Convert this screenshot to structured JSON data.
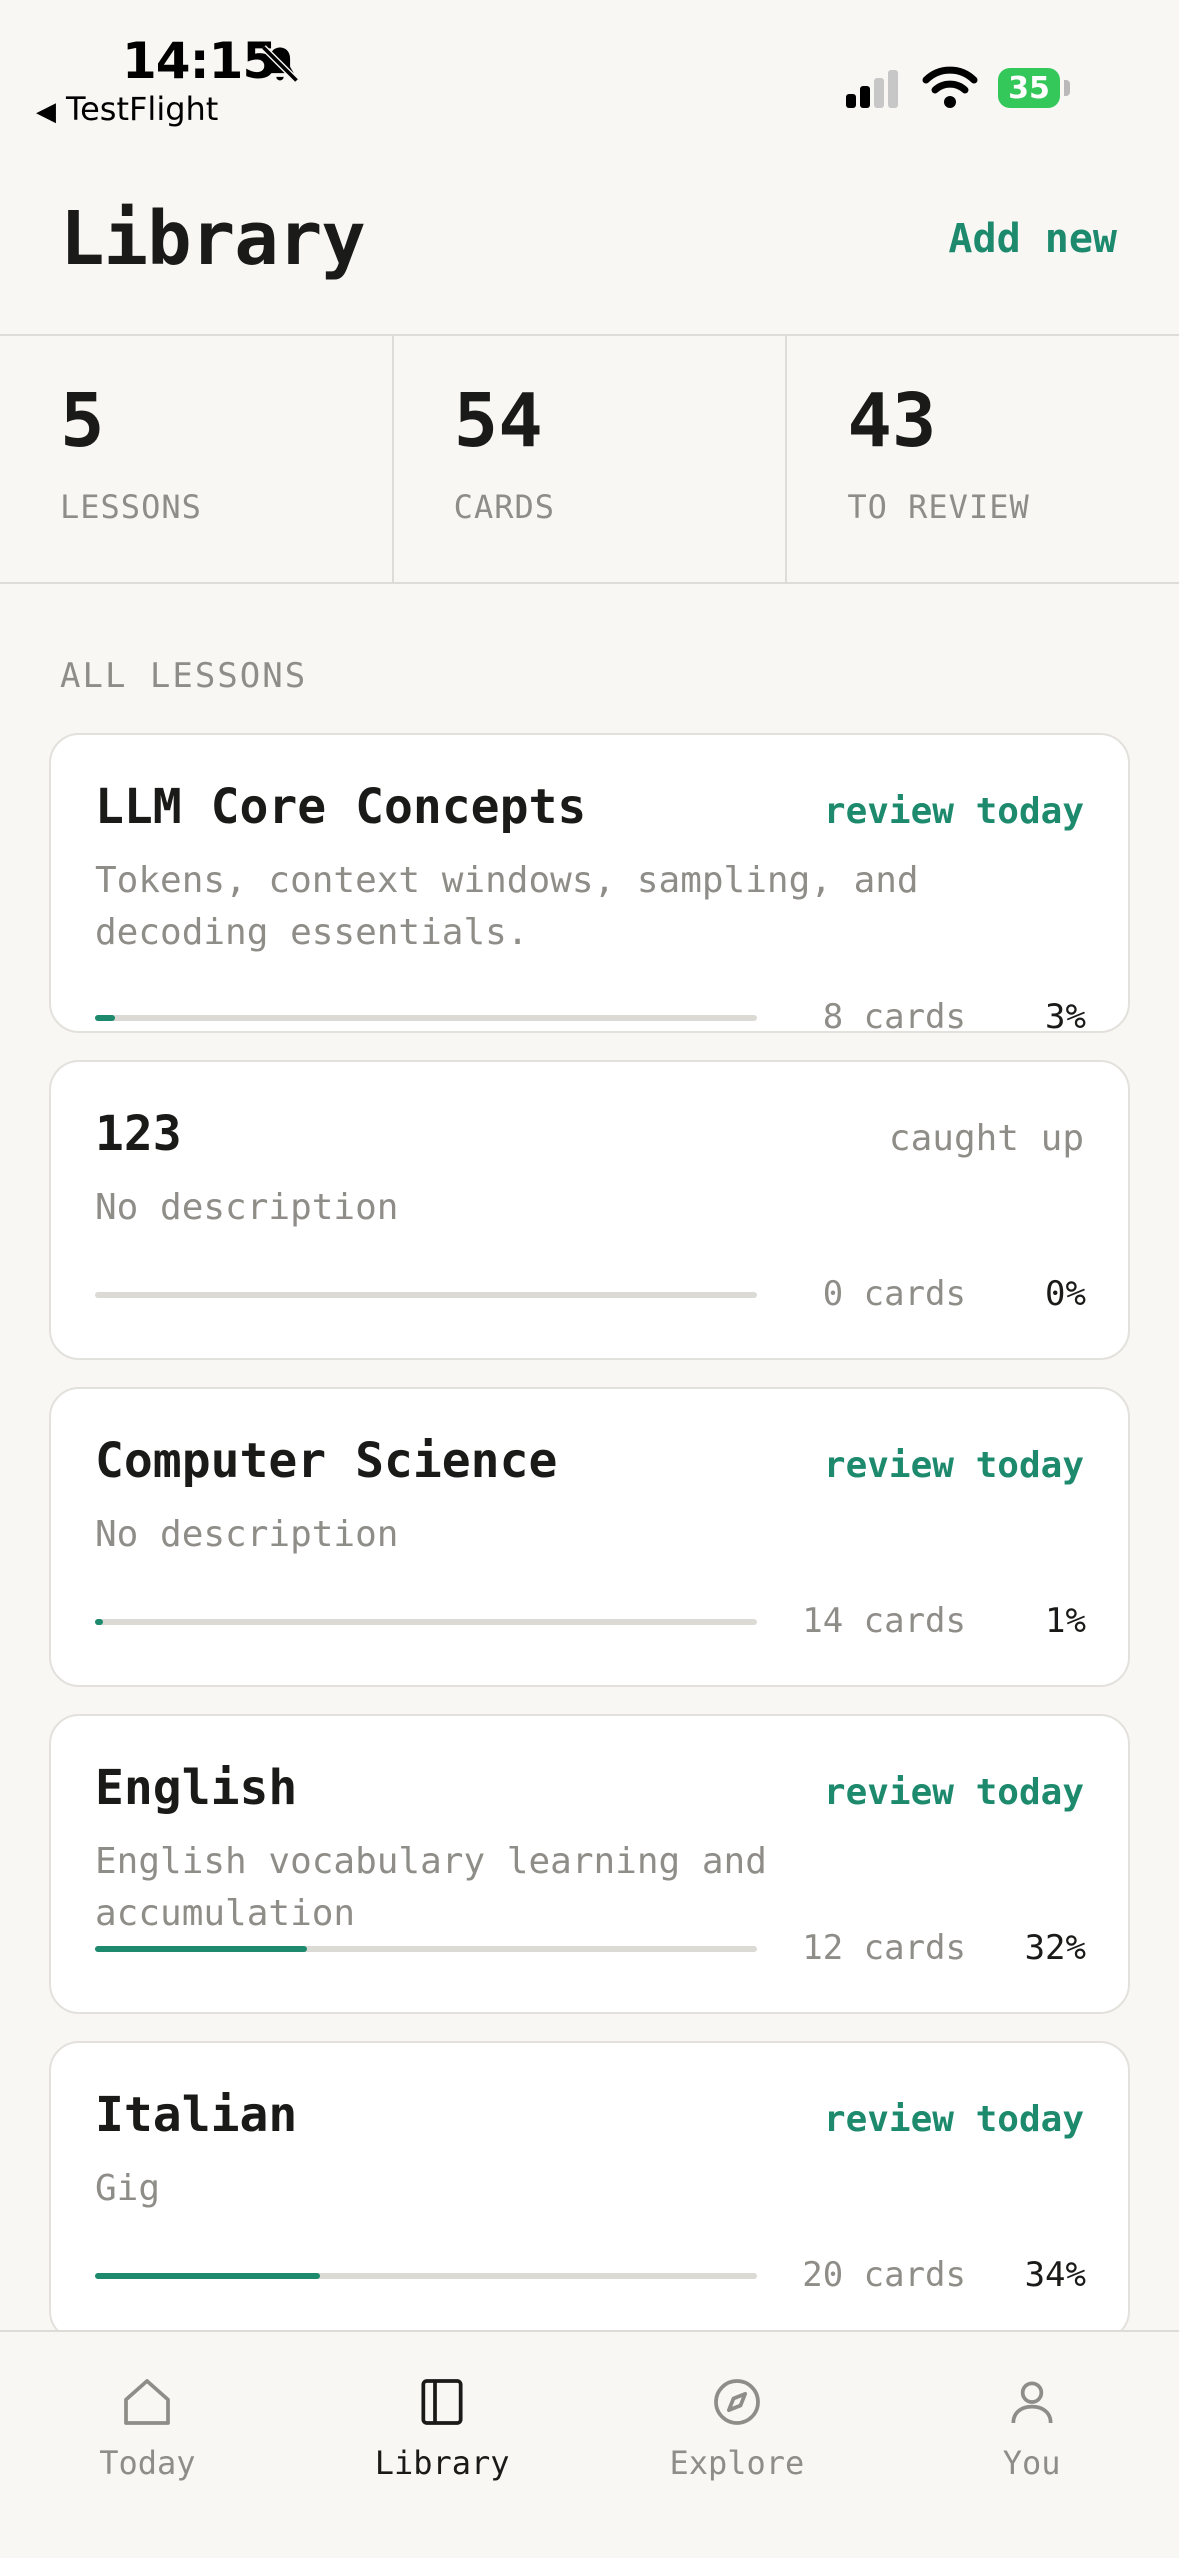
{
  "status_bar": {
    "time": "14:15",
    "back_app": "TestFlight",
    "battery": "35"
  },
  "header": {
    "title": "Library",
    "add_new": "Add new"
  },
  "stats": [
    {
      "value": "5",
      "label": "LESSONS"
    },
    {
      "value": "54",
      "label": "CARDS"
    },
    {
      "value": "43",
      "label": "TO REVIEW"
    }
  ],
  "section_label": "ALL LESSONS",
  "lessons": [
    {
      "title": "LLM Core Concepts",
      "status": "review today",
      "description": "Tokens, context windows, sampling, and decoding essentials.",
      "count": "8 cards",
      "percent": "3%",
      "progress": 0.03
    },
    {
      "title": "123",
      "status": "caught up",
      "description": "No description",
      "count": "0 cards",
      "percent": "0%",
      "progress": 0
    },
    {
      "title": "Computer Science",
      "status": "review today",
      "description": "No description",
      "count": "14 cards",
      "percent": "1%",
      "progress": 0.01
    },
    {
      "title": "English",
      "status": "review today",
      "description": "English vocabulary learning and accumulation",
      "count": "12 cards",
      "percent": "32%",
      "progress": 0.32
    },
    {
      "title": "Italian",
      "status": "review today",
      "description": "Gig",
      "count": "20 cards",
      "percent": "34%",
      "progress": 0.34
    }
  ],
  "tabs": [
    {
      "label": "Today",
      "icon": "home-icon"
    },
    {
      "label": "Library",
      "icon": "book-icon",
      "active": true
    },
    {
      "label": "Explore",
      "icon": "compass-icon"
    },
    {
      "label": "You",
      "icon": "person-icon"
    }
  ],
  "colors": {
    "accent": "#1e8a6d",
    "muted": "#8f8d88",
    "background": "#f8f7f4"
  }
}
